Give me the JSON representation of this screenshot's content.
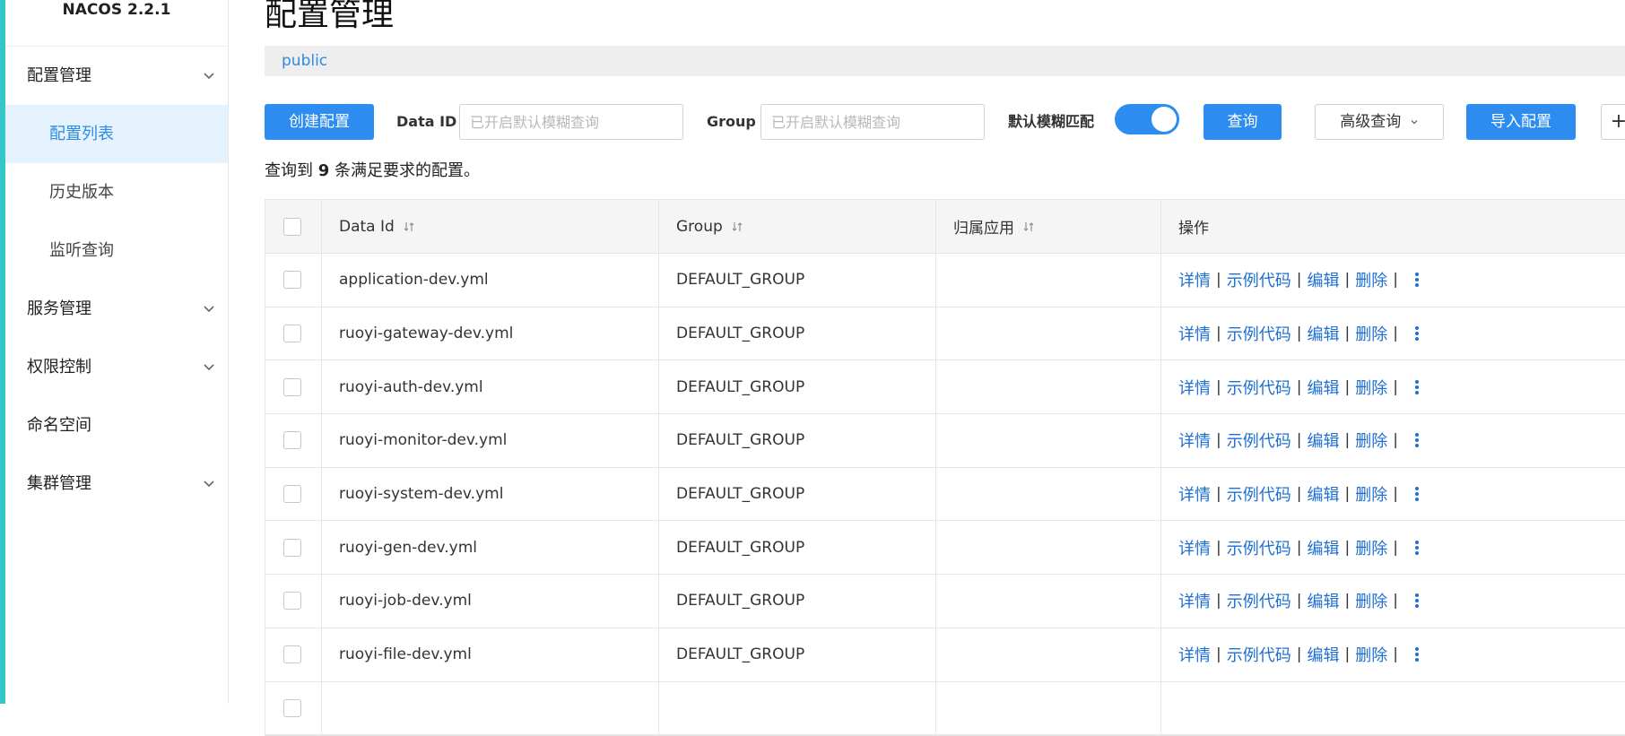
{
  "app": {
    "title": "NACOS 2.2.1"
  },
  "sidebar": {
    "items": [
      {
        "label": "配置管理",
        "expandable": true
      },
      {
        "label": "配置列表",
        "sub": true,
        "active": true
      },
      {
        "label": "历史版本",
        "sub": true
      },
      {
        "label": "监听查询",
        "sub": true
      },
      {
        "label": "服务管理",
        "expandable": true
      },
      {
        "label": "权限控制",
        "expandable": true
      },
      {
        "label": "命名空间"
      },
      {
        "label": "集群管理",
        "expandable": true
      }
    ]
  },
  "page": {
    "title": "配置管理",
    "namespace": "public"
  },
  "toolbar": {
    "create_label": "创建配置",
    "data_id_label": "Data ID",
    "data_id_placeholder": "已开启默认模糊查询",
    "group_label": "Group",
    "group_placeholder": "已开启默认模糊查询",
    "fuzzy_label": "默认模糊匹配",
    "fuzzy_enabled": true,
    "search_label": "查询",
    "advanced_label": "高级查询",
    "import_label": "导入配置",
    "more_label": "+"
  },
  "summary": {
    "prefix": "查询到",
    "count": "9",
    "suffix": "条满足要求的配置。"
  },
  "table": {
    "headers": {
      "data_id": "Data Id",
      "group": "Group",
      "app": "归属应用",
      "ops": "操作"
    },
    "ops": {
      "detail": "详情",
      "sample": "示例代码",
      "edit": "编辑",
      "delete": "删除",
      "sep": "|"
    },
    "rows": [
      {
        "data_id": "application-dev.yml",
        "group": "DEFAULT_GROUP",
        "app": ""
      },
      {
        "data_id": "ruoyi-gateway-dev.yml",
        "group": "DEFAULT_GROUP",
        "app": ""
      },
      {
        "data_id": "ruoyi-auth-dev.yml",
        "group": "DEFAULT_GROUP",
        "app": ""
      },
      {
        "data_id": "ruoyi-monitor-dev.yml",
        "group": "DEFAULT_GROUP",
        "app": ""
      },
      {
        "data_id": "ruoyi-system-dev.yml",
        "group": "DEFAULT_GROUP",
        "app": ""
      },
      {
        "data_id": "ruoyi-gen-dev.yml",
        "group": "DEFAULT_GROUP",
        "app": ""
      },
      {
        "data_id": "ruoyi-job-dev.yml",
        "group": "DEFAULT_GROUP",
        "app": ""
      },
      {
        "data_id": "ruoyi-file-dev.yml",
        "group": "DEFAULT_GROUP",
        "app": ""
      },
      {
        "data_id": "",
        "group": "",
        "app": ""
      }
    ]
  }
}
